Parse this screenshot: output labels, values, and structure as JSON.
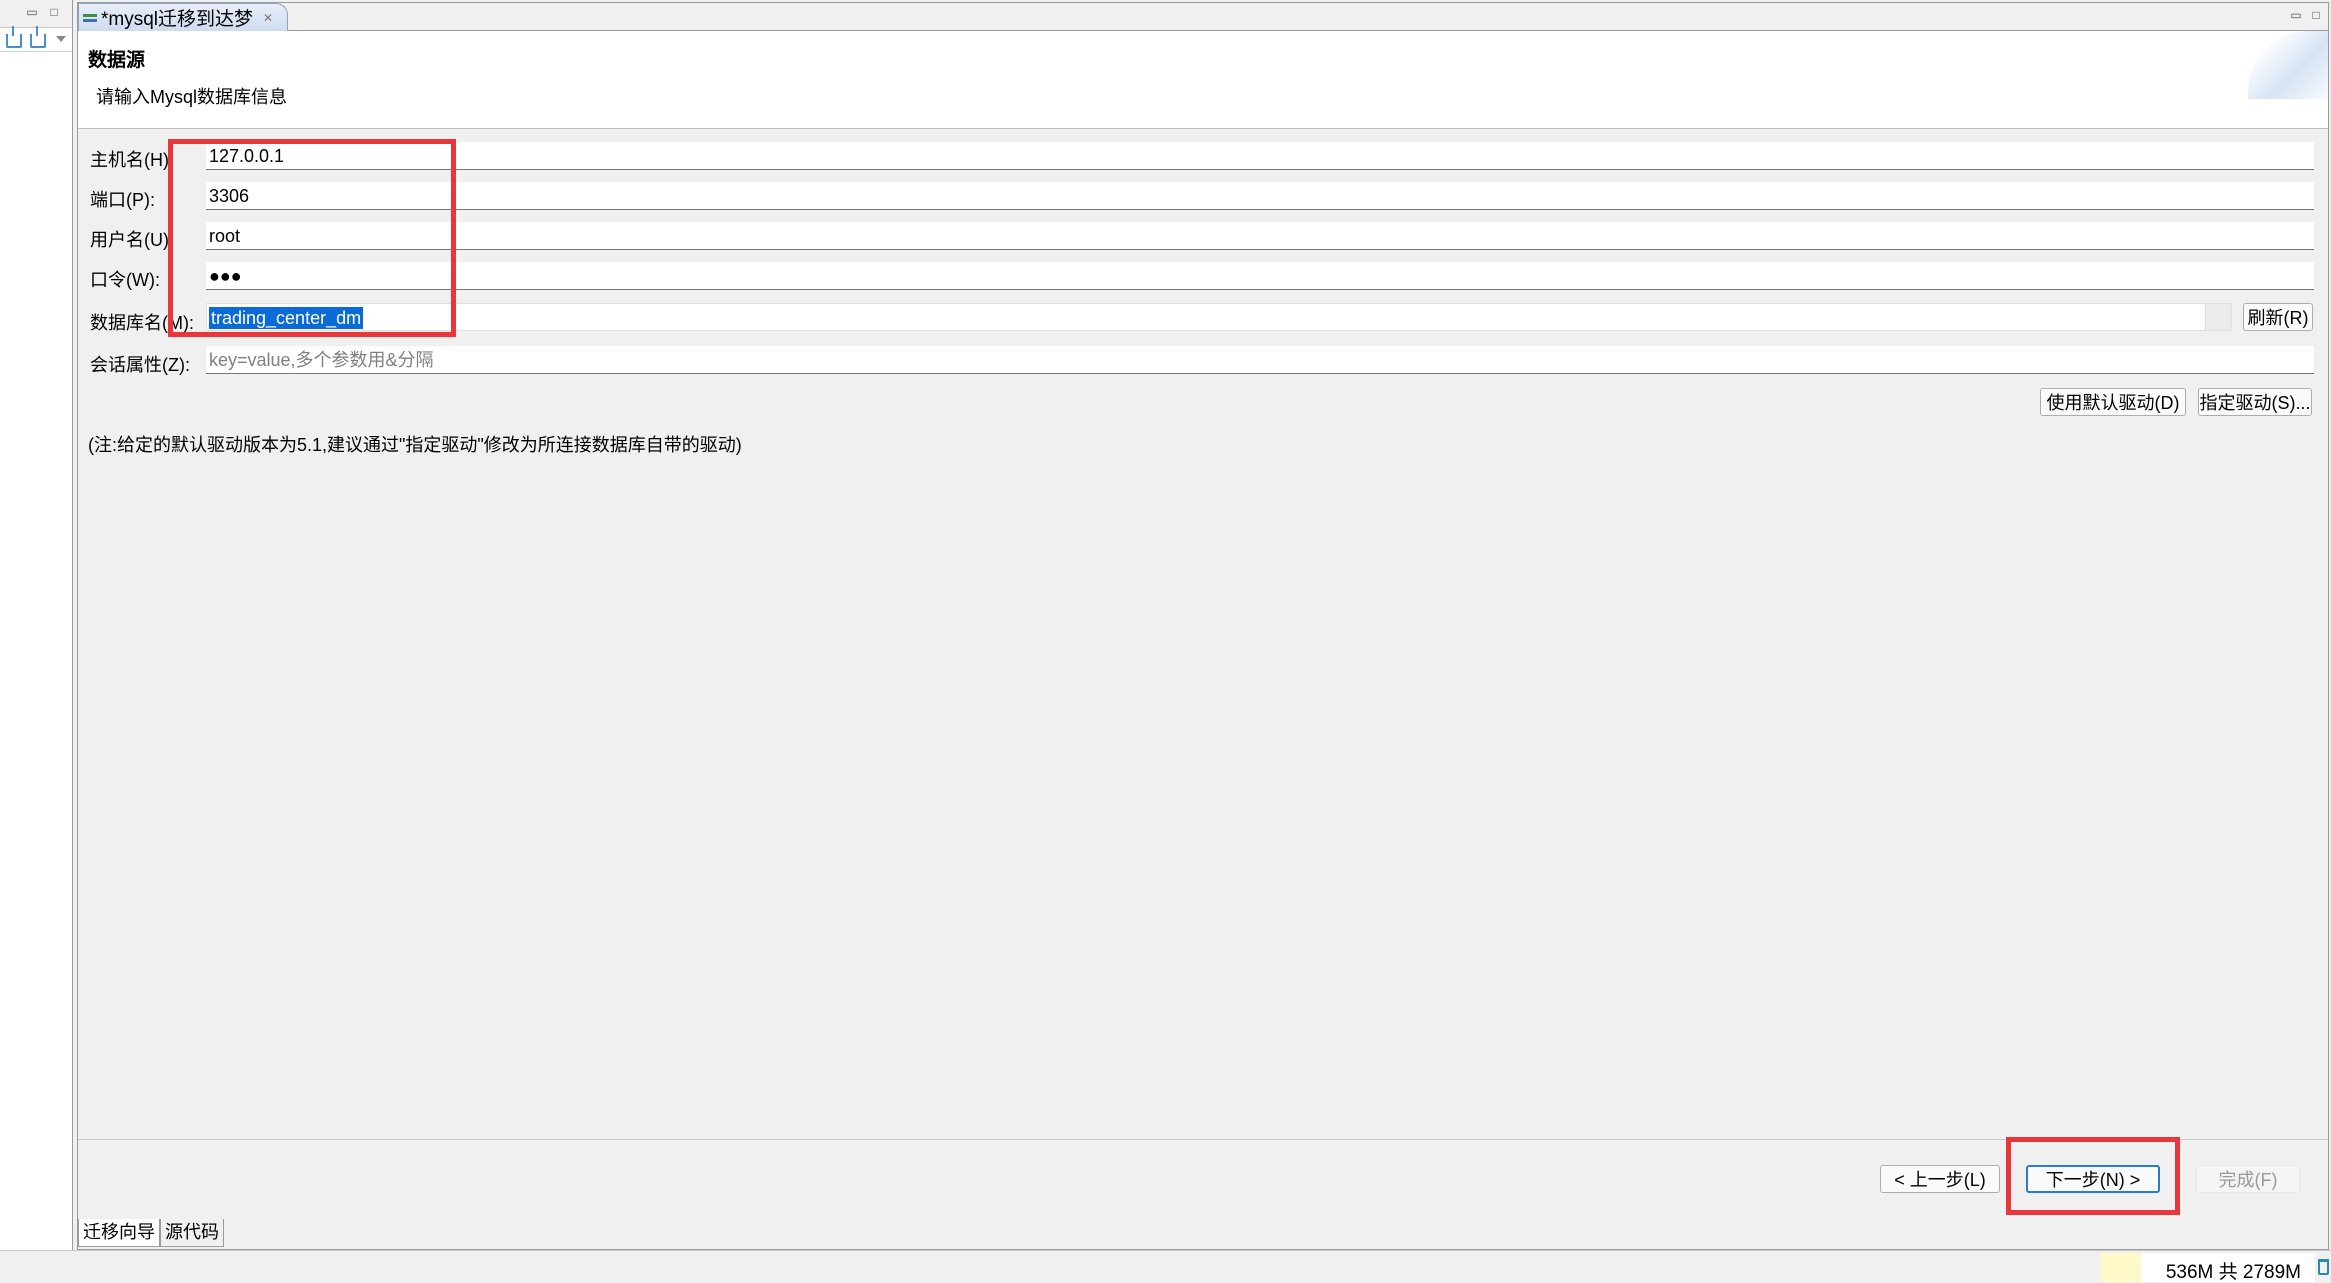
{
  "editor_tab": {
    "label": "*mysql迁移到达梦"
  },
  "wizard": {
    "title": "数据源",
    "description": "请输入Mysql数据库信息"
  },
  "form": {
    "host_label": "主机名(H):",
    "host_value": "127.0.0.1",
    "port_label": "端口(P):",
    "port_value": "3306",
    "user_label": "用户名(U):",
    "user_value": "root",
    "password_label": "口令(W):",
    "password_value": "●●●",
    "database_label": "数据库名(M):",
    "database_value": "trading_center_dm",
    "refresh_button": "刷新(R)",
    "session_label": "会话属性(Z):",
    "session_placeholder": "key=value,多个参数用&分隔",
    "default_driver_button": "使用默认驱动(D)",
    "specify_driver_button": "指定驱动(S)...",
    "note": "(注:给定的默认驱动版本为5.1,建议通过\"指定驱动\"修改为所连接数据库自带的驱动)"
  },
  "navigation": {
    "back_button": "< 上一步(L)",
    "next_button": "下一步(N) >",
    "finish_button": "完成(F)"
  },
  "bottom_tabs": [
    "迁移向导",
    "源代码"
  ],
  "status": {
    "heap_text": "536M 共 2789M",
    "heap_used_fraction": 0.19
  }
}
